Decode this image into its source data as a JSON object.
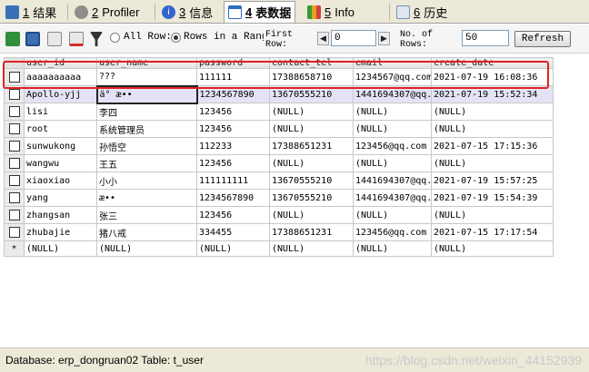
{
  "tabs": [
    {
      "num": "1",
      "label": "结果",
      "icon_color": "#3a6fb5"
    },
    {
      "num": "2",
      "label": "Profiler",
      "icon_color": "#8e8e8e"
    },
    {
      "num": "3",
      "label": "信息",
      "icon_color": "#3366cc"
    },
    {
      "num": "4",
      "label": "表数据",
      "icon_color": "#2f6cc0"
    },
    {
      "num": "5",
      "label": "Info",
      "icon_color": "#e0a020"
    },
    {
      "num": "6",
      "label": "历史",
      "icon_color": "#7a8fb0"
    }
  ],
  "toolbar": {
    "all_rows_label": "All Row:",
    "rows_range_label": "Rows in a Rang:",
    "first_row_label": "First Row:",
    "first_row_value": "0",
    "no_of_rows_label": "No. of Rows:",
    "no_of_rows_value": "50",
    "refresh_label": "Refresh",
    "selected_mode": "rows_range"
  },
  "grid": {
    "columns": [
      "user_id",
      "user_name",
      "password",
      "contact_tel",
      "email",
      "create_date"
    ],
    "rows": [
      [
        "aaaaaaaaaa",
        "???",
        "111111",
        "17388658710",
        "1234567@qq.com",
        "2021-07-19 16:08:36"
      ],
      [
        "Apollo-yjj",
        "ä° æ••",
        "1234567890",
        "13670555210",
        "1441694307@qq.",
        "2021-07-19 15:52:34"
      ],
      [
        "lisi",
        "李四",
        "123456",
        "(NULL)",
        "(NULL)",
        "(NULL)"
      ],
      [
        "root",
        "系统管理员",
        "123456",
        "(NULL)",
        "(NULL)",
        "(NULL)"
      ],
      [
        "sunwukong",
        "孙悟空",
        "112233",
        "17388651231",
        "123456@qq.com",
        "2021-07-15 17:15:36"
      ],
      [
        "wangwu",
        "王五",
        "123456",
        "(NULL)",
        "(NULL)",
        "(NULL)"
      ],
      [
        "xiaoxiao",
        "小小",
        "111111111",
        "13670555210",
        "1441694307@qq.",
        "2021-07-19 15:57:25"
      ],
      [
        "yang",
        "æ••",
        "1234567890",
        "13670555210",
        "1441694307@qq.",
        "2021-07-19 15:54:39"
      ],
      [
        "zhangsan",
        "张三",
        "123456",
        "(NULL)",
        "(NULL)",
        "(NULL)"
      ],
      [
        "zhubajie",
        "猪八戒",
        "334455",
        "17388651231",
        "123456@qq.com",
        "2021-07-15 17:17:54"
      ]
    ],
    "new_row_marker": "*",
    "new_row": [
      "(NULL)",
      "(NULL)",
      "(NULL)",
      "(NULL)",
      "(NULL)",
      "(NULL)"
    ]
  },
  "status": {
    "text": "Database: erp_dongruan02  Table: t_user",
    "watermark": "https://blog.csdn.net/weixin_44152939"
  },
  "colors": {
    "highlight_box": "#e32222",
    "selected_row": "#e3e3f5"
  }
}
